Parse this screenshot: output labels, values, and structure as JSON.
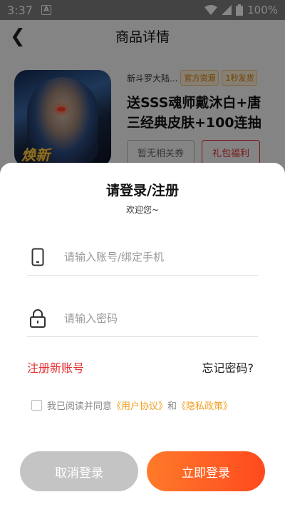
{
  "status_bar": {
    "time": "3:37",
    "notif_icon_letter": "A",
    "battery": "100%"
  },
  "header": {
    "title": "商品详情"
  },
  "product": {
    "game": "新斗罗大陆...",
    "tags": [
      "官方资源",
      "1秒发货"
    ],
    "name": "送SSS魂师戴沐白+唐三经典皮肤+100连抽",
    "thumb_label": "焕新",
    "buttons": {
      "coupon": "暂无相关券",
      "gift": "礼包福利"
    }
  },
  "login": {
    "title": "请登录/注册",
    "welcome": "欢迎您~",
    "account_placeholder": "请输入账号/绑定手机",
    "password_placeholder": "请输入密码",
    "register": "注册新账号",
    "forgot": "忘记密码?",
    "agree_prefix": "我已阅读并同意",
    "user_agreement": "《用户协议》",
    "and": "和",
    "privacy_policy": "《隐私政策》",
    "cancel": "取消登录",
    "submit": "立即登录"
  },
  "colors": {
    "accent_red": "#e53030",
    "accent_orange": "#ff5a1e",
    "link_orange": "#f0a020"
  }
}
